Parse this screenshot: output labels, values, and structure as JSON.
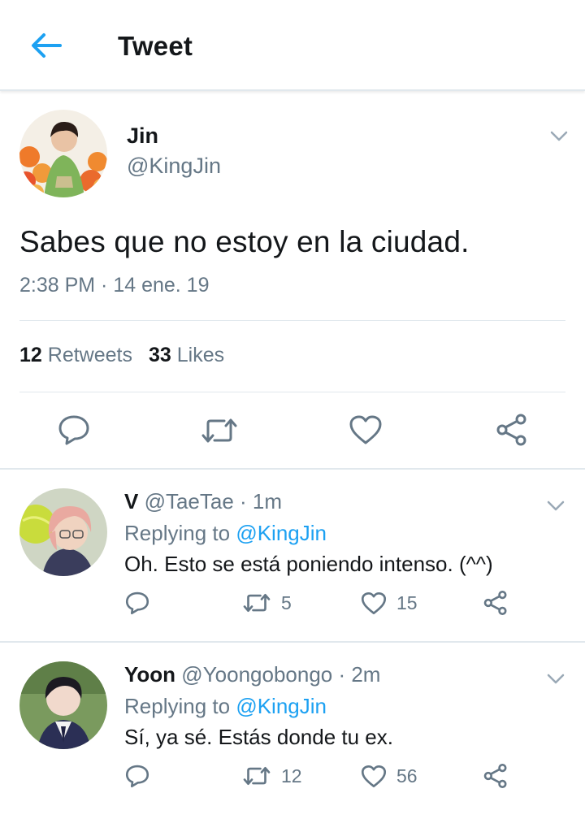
{
  "header": {
    "title": "Tweet",
    "back_icon": "arrow-left-icon",
    "accent": "#1da1f2"
  },
  "tweet": {
    "author": {
      "name": "Jin",
      "handle": "@KingJin"
    },
    "text": "Sabes que no estoy en la ciudad.",
    "timestamp": "2:38 PM · 14 ene. 19",
    "retweets": {
      "count": "12",
      "label": "Retweets"
    },
    "likes": {
      "count": "33",
      "label": "Likes"
    },
    "actions": [
      "reply-icon",
      "retweet-icon",
      "like-icon",
      "share-icon"
    ]
  },
  "replies": [
    {
      "name": "V",
      "meta": "@TaeTae · 1m",
      "replying_label": "Replying to",
      "replying_handle": "@KingJin",
      "text": "Oh. Esto se está poniendo intenso. (^^)",
      "retweets": "5",
      "likes": "15"
    },
    {
      "name": "Yoon",
      "meta": "@Yoongobongo · 2m",
      "replying_label": "Replying to",
      "replying_handle": "@KingJin",
      "text": "Sí, ya sé. Estás donde tu ex.",
      "retweets": "12",
      "likes": "56"
    }
  ],
  "colors": {
    "text": "#14171a",
    "secondary": "#657786",
    "link": "#1da1f2",
    "divider": "#e1e8ed"
  }
}
